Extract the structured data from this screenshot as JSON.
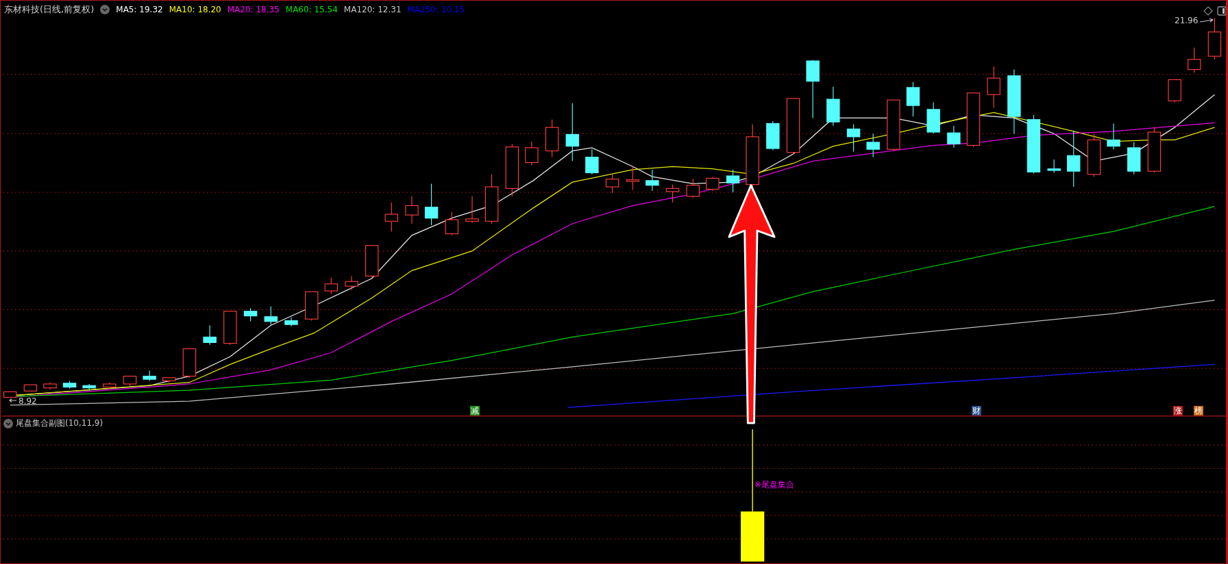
{
  "header": {
    "title": "东材科技(日线,前复权)",
    "indicators": [
      {
        "label": "MA5: 19.32",
        "color": "#ffffff"
      },
      {
        "label": "MA10: 18.20",
        "color": "#ffff00"
      },
      {
        "label": "MA20: 18.35",
        "color": "#ff00ff"
      },
      {
        "label": "MA60: 15.54",
        "color": "#00e600"
      },
      {
        "label": "MA120: 12.31",
        "color": "#c8c8c8"
      },
      {
        "label": "MA250: 10.15",
        "color": "#0000ff"
      }
    ]
  },
  "price_labels": {
    "high": "21.96",
    "low": "8.92"
  },
  "event_tags": [
    {
      "label": "减",
      "color": "#1f8f1f"
    },
    {
      "label": "财",
      "color": "#2a4f8f"
    },
    {
      "label": "涨",
      "color": "#b81c1c"
    },
    {
      "label": "榜",
      "color": "#c86a1a"
    }
  ],
  "sub_panel": {
    "title": "尾盘集合副图(10,11,9)",
    "signal_label": "※尾盘集合"
  }
}
